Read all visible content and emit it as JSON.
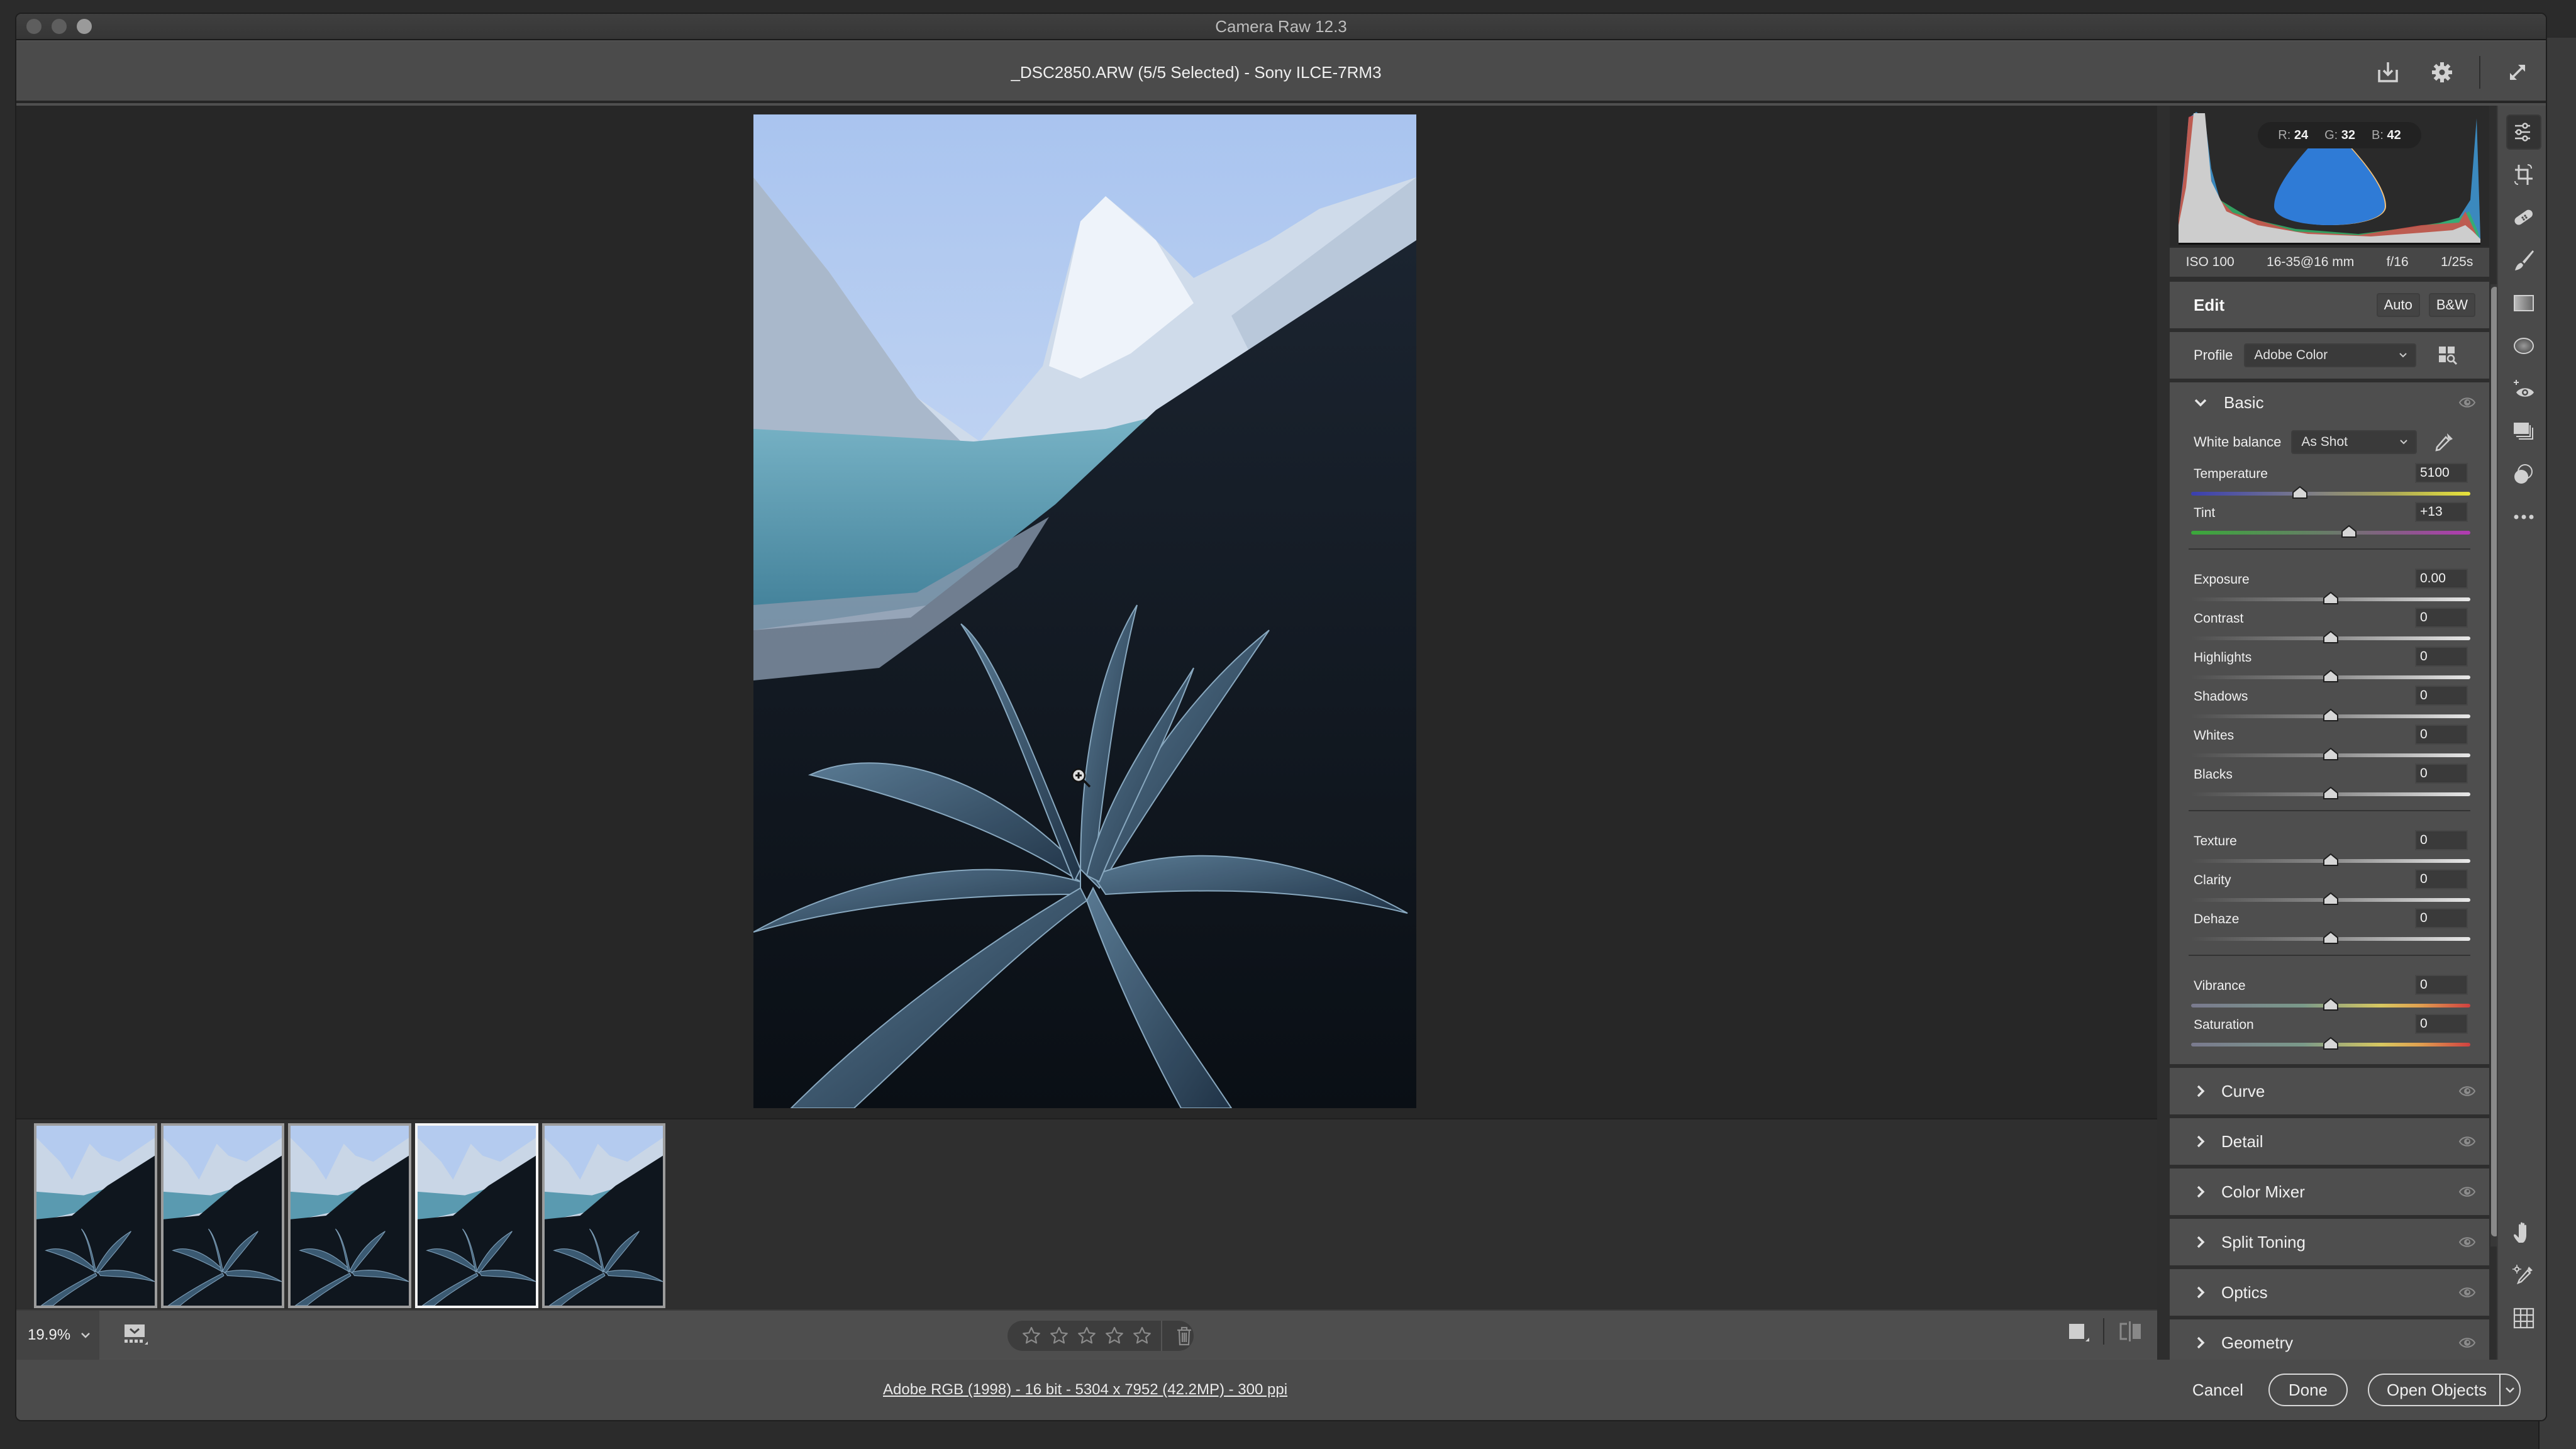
{
  "window": {
    "app_title": "Camera Raw 12.3",
    "document_title": "_DSC2850.ARW (5/5 Selected)  -  Sony ILCE-7RM3",
    "header_icons": [
      "save-image-icon",
      "preferences-gear-icon",
      "toggle-fullscreen-icon"
    ]
  },
  "histogram": {
    "readout": {
      "r_label": "R:",
      "r": "24",
      "g_label": "G:",
      "g": "32",
      "b_label": "B:",
      "b": "42"
    },
    "shadow_clip_color": "#f7c37a",
    "highlight_clip_color": "#2f7bd6"
  },
  "exif": {
    "iso": "ISO 100",
    "lens": "16-35@16 mm",
    "aperture": "f/16",
    "shutter": "1/25s"
  },
  "edit": {
    "title": "Edit",
    "auto_label": "Auto",
    "bw_label": "B&W",
    "profile_label": "Profile",
    "profile_value": "Adobe Color",
    "basic": {
      "title": "Basic",
      "white_balance_label": "White balance",
      "white_balance_value": "As Shot",
      "wb_sliders": [
        {
          "label": "Temperature",
          "value": "5100",
          "position": 0.39,
          "track": "temp"
        },
        {
          "label": "Tint",
          "value": "+13",
          "position": 0.565,
          "track": "tint"
        }
      ],
      "tone_sliders": [
        {
          "label": "Exposure",
          "value": "0.00",
          "position": 0.5,
          "track": "gray"
        },
        {
          "label": "Contrast",
          "value": "0",
          "position": 0.5,
          "track": "gray"
        },
        {
          "label": "Highlights",
          "value": "0",
          "position": 0.5,
          "track": "gray"
        },
        {
          "label": "Shadows",
          "value": "0",
          "position": 0.5,
          "track": "gray"
        },
        {
          "label": "Whites",
          "value": "0",
          "position": 0.5,
          "track": "gray"
        },
        {
          "label": "Blacks",
          "value": "0",
          "position": 0.5,
          "track": "gray"
        }
      ],
      "presence_sliders": [
        {
          "label": "Texture",
          "value": "0",
          "position": 0.5,
          "track": "gray"
        },
        {
          "label": "Clarity",
          "value": "0",
          "position": 0.5,
          "track": "gray"
        },
        {
          "label": "Dehaze",
          "value": "0",
          "position": 0.5,
          "track": "gray"
        }
      ],
      "color_sliders": [
        {
          "label": "Vibrance",
          "value": "0",
          "position": 0.5,
          "track": "sat"
        },
        {
          "label": "Saturation",
          "value": "0",
          "position": 0.5,
          "track": "sat"
        }
      ]
    },
    "collapsed_sections": [
      "Curve",
      "Detail",
      "Color Mixer",
      "Split Toning",
      "Optics",
      "Geometry"
    ]
  },
  "tools": [
    "edit-sliders-icon",
    "crop-rotate-icon",
    "spot-removal-bandage-icon",
    "adjustment-brush-icon",
    "graduated-filter-icon",
    "radial-filter-icon",
    "red-eye-icon",
    "snapshots-icon",
    "presets-icon",
    "more-options-icon"
  ],
  "bottom_tools": [
    "hand-tool-icon",
    "color-sampler-icon",
    "grid-overlay-icon"
  ],
  "filmstrip": {
    "count": 5,
    "selected_index": 3
  },
  "bottombar": {
    "zoom_level": "19.9%",
    "rating_stars": 0,
    "rating_max": 5
  },
  "footer": {
    "workflow_options": "Adobe RGB (1998) - 16 bit - 5304 x 7952 (42.2MP) - 300 ppi",
    "cancel_label": "Cancel",
    "done_label": "Done",
    "open_label": "Open Objects"
  }
}
